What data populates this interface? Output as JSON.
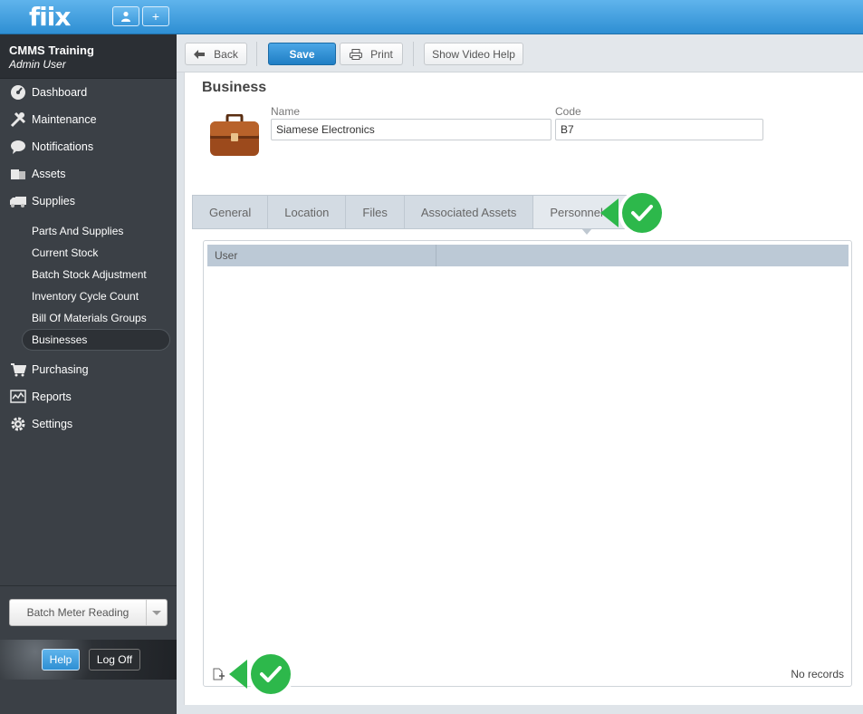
{
  "app": {
    "logo": "fiix",
    "user_btn_icon": "user-icon",
    "add_btn_icon": "plus-icon"
  },
  "sidebar": {
    "org_name": "CMMS Training",
    "user_role": "Admin User",
    "items": [
      {
        "label": "Dashboard",
        "icon": "dashboard-icon"
      },
      {
        "label": "Maintenance",
        "icon": "tools-icon"
      },
      {
        "label": "Notifications",
        "icon": "speech-bubble-icon"
      },
      {
        "label": "Assets",
        "icon": "boxes-icon"
      },
      {
        "label": "Supplies",
        "icon": "truck-icon"
      }
    ],
    "supplies_sub": [
      "Parts And Supplies",
      "Current Stock",
      "Batch Stock Adjustment",
      "Inventory Cycle Count",
      "Bill Of Materials Groups",
      "Businesses"
    ],
    "items_after": [
      {
        "label": "Purchasing",
        "icon": "cart-icon"
      },
      {
        "label": "Reports",
        "icon": "chart-icon"
      },
      {
        "label": "Settings",
        "icon": "gear-icon"
      }
    ],
    "batch_meter": "Batch Meter Reading",
    "help": "Help",
    "logoff": "Log Off"
  },
  "toolbar": {
    "back": "Back",
    "save": "Save",
    "print": "Print",
    "video_help": "Show Video Help"
  },
  "form": {
    "title": "Business",
    "name_label": "Name",
    "name_value": "Siamese Electronics",
    "code_label": "Code",
    "code_value": "B7"
  },
  "tabs": [
    "General",
    "Location",
    "Files",
    "Associated Assets",
    "Personnel"
  ],
  "active_tab": "Personnel",
  "grid": {
    "columns": [
      "User"
    ],
    "empty_text": "No records"
  },
  "colors": {
    "accent": "#2e8fd3",
    "sidebar": "#3b4046",
    "check_badge": "#2db84b"
  }
}
